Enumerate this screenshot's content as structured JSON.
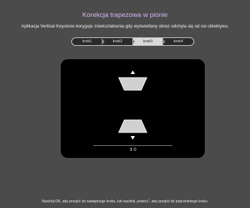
{
  "header": {
    "title": "Korekcja trapezowa w pionie",
    "description": "Aplikacja Vertical Keystone koryguje zniekształcenia gdy wyświetlany obraz odchyla się od osi obiektywu."
  },
  "steps": {
    "items": [
      {
        "label": "krok1"
      },
      {
        "label": "krok2"
      },
      {
        "label": "krok3"
      },
      {
        "label": "krok4"
      }
    ],
    "active": "krok3"
  },
  "keystone": {
    "value": "0",
    "up_arrow": "▲",
    "down_arrow": "▼",
    "adjust_icon": "⇕"
  },
  "footer": {
    "hint": "Naciśnij OK, aby przejść do następnego kroku, lub naciśnij „wstecz”, aby przejść do poprzedniego kroku."
  },
  "colors": {
    "background": "#4b4b4b",
    "title": "#d8b4f0",
    "panel": "#000000",
    "active_step": "#d9d9d9",
    "shape_fill": "#d0d0d0"
  },
  "icons": [
    "up-arrow-icon",
    "down-arrow-icon",
    "trapezoid-top-icon",
    "trapezoid-bottom-icon",
    "updown-adjust-icon"
  ]
}
